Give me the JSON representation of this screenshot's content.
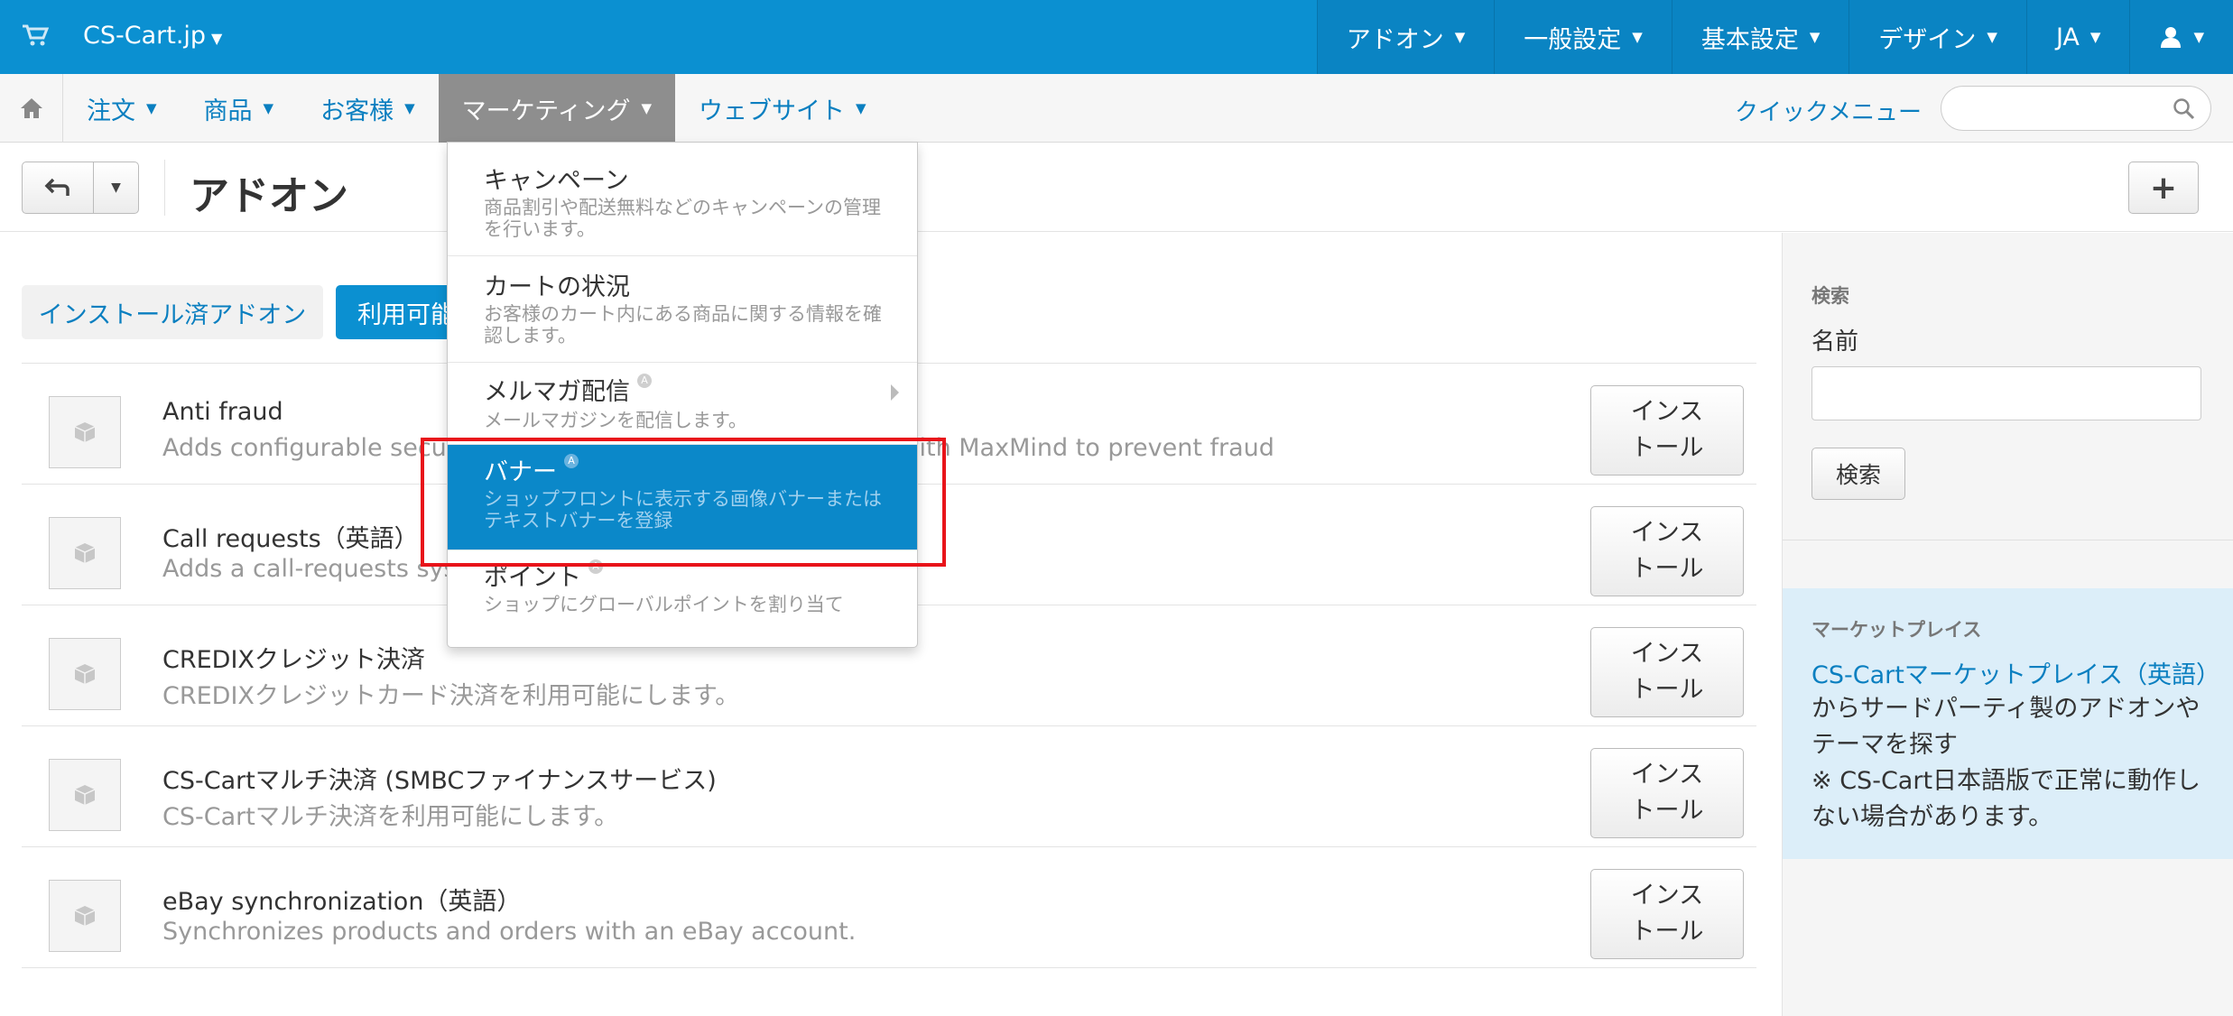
{
  "topbar": {
    "brand": "CS-Cart.jp",
    "menu": [
      {
        "label": "アドオン"
      },
      {
        "label": "一般設定"
      },
      {
        "label": "基本設定"
      },
      {
        "label": "デザイン"
      },
      {
        "label": "JA"
      }
    ],
    "icons": {
      "cart": "cart-icon",
      "user": "user-icon"
    }
  },
  "subnav": {
    "items": [
      {
        "label": "注文"
      },
      {
        "label": "商品"
      },
      {
        "label": "お客様"
      },
      {
        "label": "マーケティング",
        "active": true
      },
      {
        "label": "ウェブサイト"
      }
    ],
    "quick_menu": "クイックメニュー",
    "search_placeholder": ""
  },
  "toolbar": {
    "title": "アドオン",
    "plus_label": "+"
  },
  "tabs": {
    "installed": "インストール済アドオン",
    "available": "利用可能なアドオン"
  },
  "addons": [
    {
      "name": "Anti fraud",
      "desc": "Adds configurable security checks for orders and integrates with MaxMind to prevent fraud",
      "action": "インス\nトール"
    },
    {
      "name": "Call requests（英語）",
      "desc": "Adds a call-requests system",
      "action": "インス\nトール"
    },
    {
      "name": "CREDIXクレジット決済",
      "desc": "CREDIXクレジットカード決済を利用可能にします。",
      "action": "インス\nトール"
    },
    {
      "name": "CS-Cartマルチ決済 (SMBCファイナンスサービス)",
      "desc": "CS-Cartマルチ決済を利用可能にします。",
      "action": "インス\nトール"
    },
    {
      "name": "eBay synchronization（英語）",
      "desc": "Synchronizes products and orders with an eBay account.",
      "action": "インス\nトール"
    }
  ],
  "install_label": {
    "line1": "インス",
    "line2": "トール"
  },
  "dropdown": {
    "items": [
      {
        "title": "キャンペーン",
        "desc": "商品割引や配送無料などのキャンペーンの管理を行います。",
        "badge": false,
        "submenu": false
      },
      {
        "title": "カートの状況",
        "desc": "お客様のカート内にある商品に関する情報を確認します。",
        "badge": false,
        "submenu": false
      },
      {
        "title": "メルマガ配信",
        "desc": "メールマガジンを配信します。",
        "badge": true,
        "submenu": true
      },
      {
        "title": "バナー",
        "desc": "ショップフロントに表示する画像バナーまたはテキストバナーを登録",
        "badge": true,
        "submenu": false,
        "active": true
      },
      {
        "title": "ポイント",
        "desc": "ショップにグローバルポイントを割り当て",
        "badge": true,
        "submenu": false
      }
    ],
    "badge_glyph": "A"
  },
  "sidebar": {
    "search_heading": "検索",
    "name_label": "名前",
    "search_button": "検索",
    "market_heading": "マーケットプレイス",
    "market_link": "CS-Cartマーケットプレイス（英語）",
    "market_text": "からサードパーティ製のアドオンやテーマを探す",
    "market_note": "※ CS-Cart日本語版で正常に動作しない場合があります。"
  },
  "colors": {
    "primary": "#0b90d1",
    "highlight": "#e8141a"
  }
}
